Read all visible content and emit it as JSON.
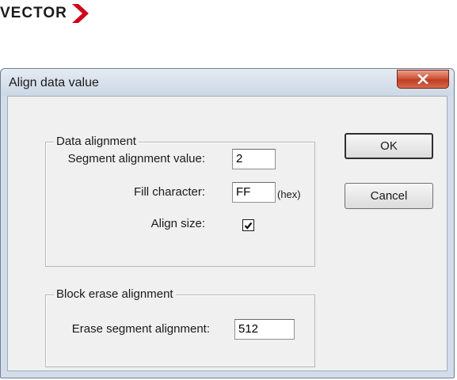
{
  "logo": {
    "text": "VECTOR",
    "chevron_color": "#d0021b"
  },
  "dialog": {
    "title": "Align data value",
    "close_icon": "close-x-icon",
    "data_alignment": {
      "legend": "Data alignment",
      "segment_label": "Segment alignment value:",
      "segment_value": "2",
      "fill_label": "Fill character:",
      "fill_value": "FF",
      "fill_suffix": "(hex)",
      "align_size_label": "Align size:",
      "align_size_checked": true
    },
    "block_erase": {
      "legend": "Block erase alignment",
      "erase_label": "Erase segment alignment:",
      "erase_value": "512"
    },
    "buttons": {
      "ok": "OK",
      "cancel": "Cancel"
    }
  }
}
